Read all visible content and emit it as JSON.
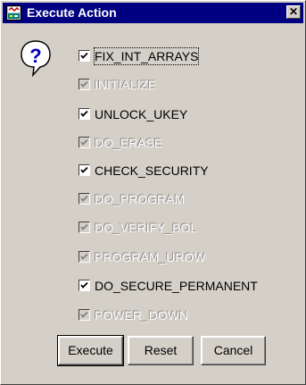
{
  "window": {
    "title": "Execute Action",
    "close_label": "✕"
  },
  "icons": {
    "app": "app-icon",
    "question": "question-icon"
  },
  "options": [
    {
      "label": "FIX_INT_ARRAYS",
      "checked": true,
      "enabled": true
    },
    {
      "label": "INITIALIZE",
      "checked": true,
      "enabled": false
    },
    {
      "label": "UNLOCK_UKEY",
      "checked": true,
      "enabled": true
    },
    {
      "label": "DO_ERASE",
      "checked": true,
      "enabled": false
    },
    {
      "label": "CHECK_SECURITY",
      "checked": true,
      "enabled": true
    },
    {
      "label": "DO_PROGRAM",
      "checked": true,
      "enabled": false
    },
    {
      "label": "DO_VERIFY_BOL",
      "checked": true,
      "enabled": false
    },
    {
      "label": "PROGRAM_UROW",
      "checked": true,
      "enabled": false
    },
    {
      "label": "DO_SECURE_PERMANENT",
      "checked": true,
      "enabled": true
    },
    {
      "label": "POWER_DOWN",
      "checked": true,
      "enabled": false
    }
  ],
  "buttons": {
    "execute": "Execute",
    "reset": "Reset",
    "cancel": "Cancel"
  }
}
